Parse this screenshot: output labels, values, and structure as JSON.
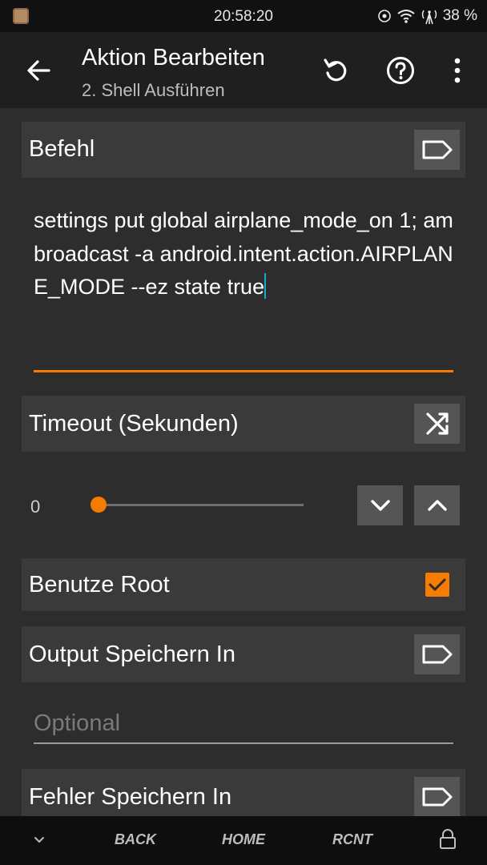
{
  "status_bar": {
    "time": "20:58:20",
    "battery": "38 %"
  },
  "app_bar": {
    "title": "Aktion Bearbeiten",
    "subtitle": "2. Shell Ausführen"
  },
  "command": {
    "label": "Befehl",
    "value": "settings put global airplane_mode_on 1; am broadcast -a android.intent.action.AIRPLANE_MODE --ez state true"
  },
  "timeout": {
    "label": "Timeout (Sekunden)",
    "value": "0",
    "slider_fraction": 0.0
  },
  "root": {
    "label": "Benutze Root",
    "checked": true
  },
  "output": {
    "label": "Output Speichern In",
    "placeholder": "Optional"
  },
  "error": {
    "label": "Fehler Speichern In"
  },
  "nav_bar": {
    "back": "BACK",
    "home": "HOME",
    "recent": "RCNT"
  },
  "colors": {
    "accent": "#f57c00",
    "background": "#2d2d2d",
    "section": "#3a3a3a",
    "button": "#555555"
  }
}
